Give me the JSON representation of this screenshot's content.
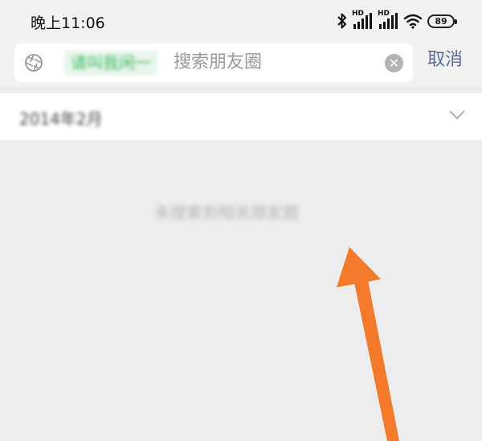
{
  "status_bar": {
    "time": "晚上11:06",
    "signal_labels": [
      "HD",
      "HD"
    ],
    "battery": "89"
  },
  "search": {
    "tag": "请叫我闲一",
    "placeholder": "搜索朋友圈",
    "clear_icon": "clear-icon",
    "cancel_label": "取消"
  },
  "filter": {
    "date_label": "2014年2月",
    "expand_icon": "chevron-down-icon"
  },
  "results": {
    "empty_message": "未搜索到相关朋友圈"
  },
  "colors": {
    "accent_link": "#576b95",
    "tag_green": "#3cb95e",
    "annotation_arrow": "#f47a2b"
  }
}
